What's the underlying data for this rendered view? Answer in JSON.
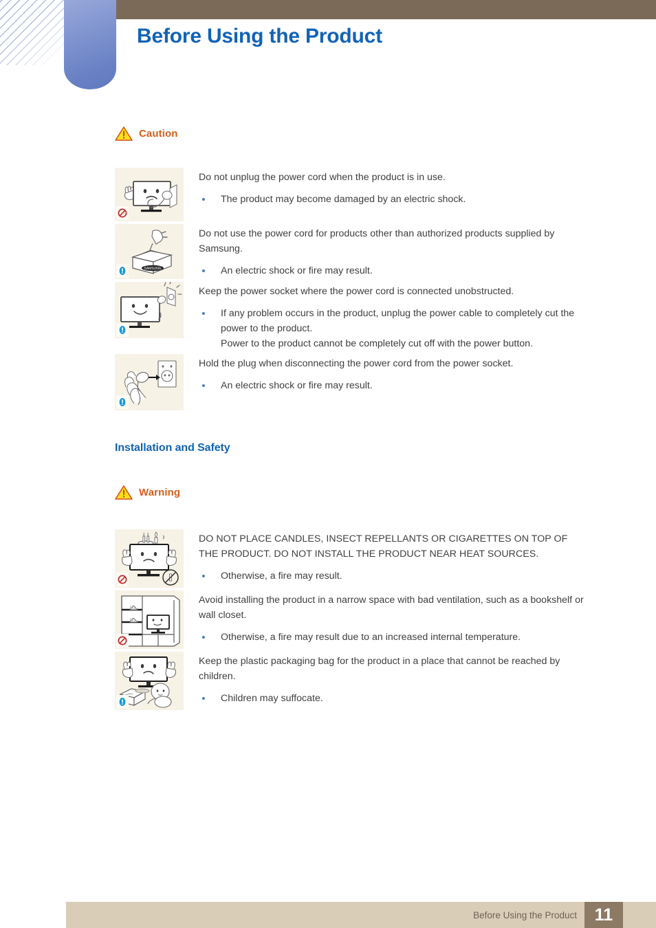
{
  "header": {
    "title": "Before Using the Product",
    "title_color": "#1263b5",
    "bar_color": "#7b6a57",
    "tab_color": "#6a82c4"
  },
  "sections": [
    {
      "id": "caution",
      "notice": {
        "label": "Caution",
        "icon": "warning-triangle-icon",
        "color": "#d4601d"
      },
      "items": [
        {
          "icon": "monitor-unplug-cord-illustration",
          "badge": "prohibited-badge",
          "lead": "Do not unplug the power cord when the product is in use.",
          "caps": false,
          "bullets": [
            "The product may become damaged by an electric shock."
          ],
          "extra": []
        },
        {
          "icon": "plug-into-samsung-box-illustration",
          "badge": "info-badge",
          "lead": "Do not use the power cord for products other than authorized products supplied by Samsung.",
          "caps": false,
          "bullets": [
            "An electric shock or fire may result."
          ],
          "extra": []
        },
        {
          "icon": "monitor-accessible-socket-illustration",
          "badge": "info-badge",
          "lead": "Keep the power socket where the power cord is connected unobstructed.",
          "caps": false,
          "bullets": [
            "If any problem occurs in the product, unplug the power cable to completely cut the power to the product."
          ],
          "extra": [
            "Power to the product cannot be completely cut off with the power button."
          ]
        },
        {
          "icon": "hand-holding-plug-illustration",
          "badge": "info-badge",
          "lead": "Hold the plug when disconnecting the power cord from the power socket.",
          "caps": false,
          "bullets": [
            "An electric shock or fire may result."
          ],
          "extra": []
        }
      ]
    },
    {
      "id": "installation-and-safety",
      "heading": "Installation and Safety",
      "notice": {
        "label": "Warning",
        "icon": "warning-triangle-icon",
        "color": "#d4601d"
      },
      "items": [
        {
          "icon": "candles-on-monitor-illustration",
          "badge": "prohibited-badge",
          "lead": "DO NOT PLACE CANDLES, INSECT REPELLANTS OR CIGARETTES ON TOP OF THE PRODUCT. DO NOT INSTALL THE PRODUCT NEAR HEAT SOURCES.",
          "caps": true,
          "bullets": [
            "Otherwise, a fire may result."
          ],
          "extra": []
        },
        {
          "icon": "monitor-in-bookshelf-illustration",
          "badge": "prohibited-badge",
          "lead": "Avoid installing the product in a narrow space with bad ventilation, such as a bookshelf or wall closet.",
          "caps": false,
          "bullets": [
            "Otherwise, a fire may result due to an increased internal temperature."
          ],
          "extra": []
        },
        {
          "icon": "child-with-packaging-bag-illustration",
          "badge": "info-badge",
          "lead": "Keep the plastic packaging bag for the product in a place that cannot be reached by children.",
          "caps": false,
          "bullets": [
            "Children may suffocate."
          ],
          "extra": []
        }
      ]
    }
  ],
  "footer": {
    "label": "Before Using the Product",
    "page_number": "11",
    "bar_color": "#d9cdb8",
    "page_box_color": "#8d7a64"
  }
}
